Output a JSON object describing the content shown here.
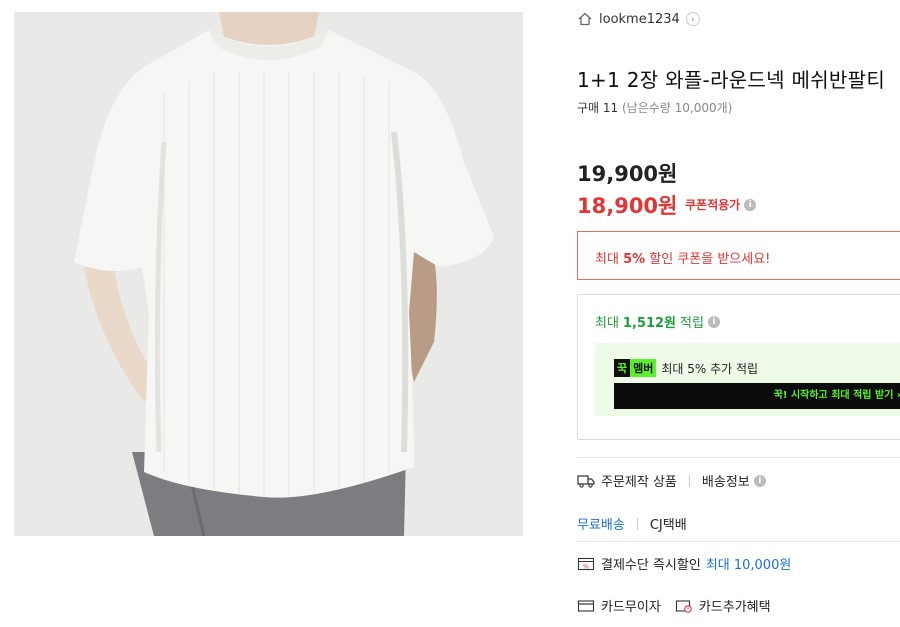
{
  "store": {
    "name": "lookme1234",
    "chevron": "›",
    "home_icon": "home-icon"
  },
  "product": {
    "title": "1+1 2장 와플-라운드넥 메쉬반팔티",
    "purchase_label": "구매 11",
    "remaining": "(남은수량 10,000개)",
    "original_price": "19,900원",
    "sale_price": "18,900원",
    "coupon_price_label": "쿠폰적용가"
  },
  "coupon": {
    "prefix": "최대 ",
    "percent": "5%",
    "suffix": " 할인 쿠폰을 받으세요!"
  },
  "points": {
    "prefix": "최대",
    "amount": "1,512원",
    "suffix": "적립",
    "member_badge_left": "꾹",
    "member_badge_right": "멤버",
    "member_text": "최대 5% 추가 적립",
    "member_cta": "꾹! 시작하고 최대 적립 받기 ›"
  },
  "shipping": {
    "made_to_order": "주문제작 상품",
    "delivery_info": "배송정보",
    "free_shipping": "무료배송",
    "carrier": "CJ택배"
  },
  "payment": {
    "instant_discount": "결제수단 즉시할인",
    "instant_discount_max": "최대 10,000원",
    "installment": "카드무이자",
    "card_benefit": "카드추가혜택"
  },
  "colors": {
    "sale_red": "#e03636",
    "point_green": "#1a9f3d",
    "link_blue": "#1a6fd6",
    "member_green": "#5cf02a"
  }
}
